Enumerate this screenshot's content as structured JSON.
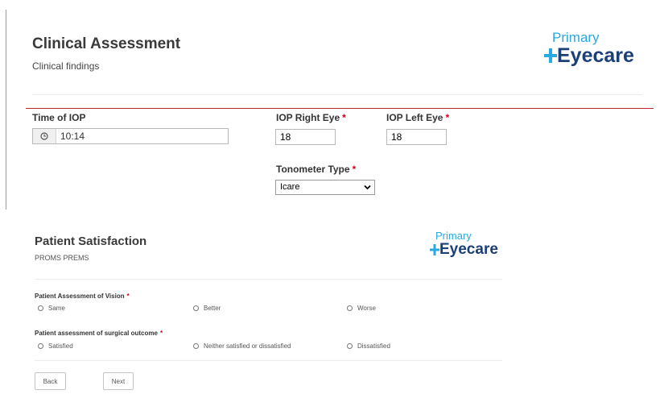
{
  "clinical": {
    "title": "Clinical Assessment",
    "subtitle": "Clinical findings",
    "time_of_iop": {
      "label": "Time of IOP",
      "value": "10:14"
    },
    "iop_right": {
      "label": "IOP Right Eye",
      "required_mark": "*",
      "value": "18"
    },
    "iop_left": {
      "label": "IOP Left Eye",
      "required_mark": "*",
      "value": "18"
    },
    "tonometer": {
      "label": "Tonometer Type",
      "required_mark": "*",
      "selected": "Icare"
    }
  },
  "logo": {
    "line1": "Primary",
    "line2": "Eyecare"
  },
  "satisfaction": {
    "title": "Patient Satisfaction",
    "subtitle": "PROMS PREMS",
    "q1": {
      "label": "Patient Assessment of Vision",
      "required_mark": "*",
      "options": [
        "Same",
        "Better",
        "Worse"
      ]
    },
    "q2": {
      "label": "Patient assessment of surgical outcome",
      "required_mark": "*",
      "options": [
        "Satisfied",
        "Neither satisfied or dissatisfied",
        "Dissatisfied"
      ]
    },
    "back_label": "Back",
    "next_label": "Next"
  },
  "colors": {
    "required": "#d0021b",
    "divider": "#b5282b",
    "logo_light": "#29a9df",
    "logo_dark": "#1c3f78"
  },
  "icons": {
    "time": "clock-icon",
    "select": "chevron-down-icon",
    "logo_cross": "plus-cross-icon"
  }
}
